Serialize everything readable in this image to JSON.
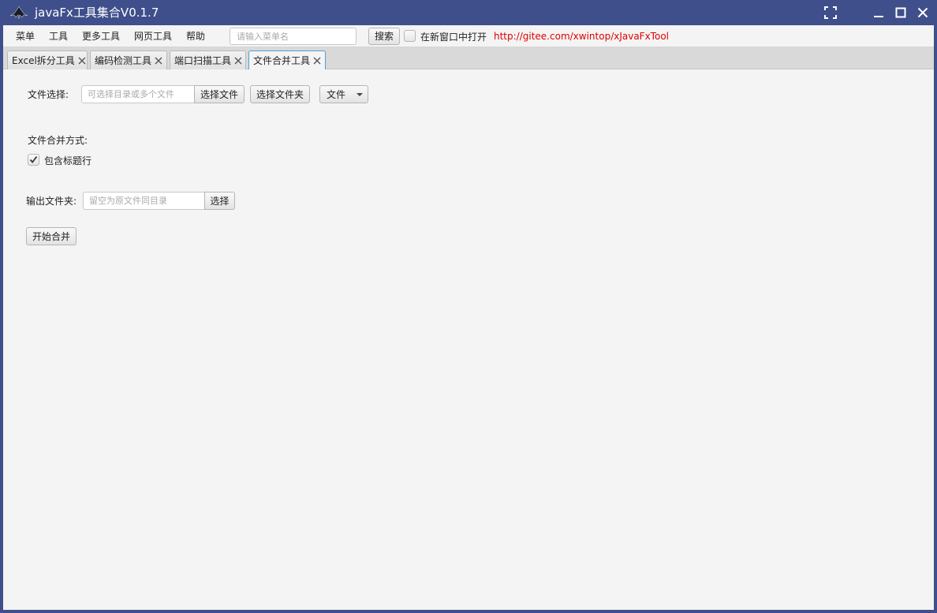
{
  "window": {
    "title": "javaFx工具集合V0.1.7",
    "title_bar_color": "#3f4f8b"
  },
  "menubar": {
    "items": [
      "菜单",
      "工具",
      "更多工具",
      "网页工具",
      "帮助"
    ],
    "search_placeholder": "请输入菜单名",
    "search_value": "",
    "search_button": "搜索",
    "new_window_label": "在新窗口中打开",
    "new_window_checked": false,
    "project_link": "http://gitee.com/xwintop/xJavaFxTool",
    "link_color": "#e00000"
  },
  "tabs": [
    {
      "label": "Excel拆分工具",
      "active": false
    },
    {
      "label": "编码检测工具",
      "active": false
    },
    {
      "label": "端口扫描工具",
      "active": false
    },
    {
      "label": "文件合并工具",
      "active": true
    }
  ],
  "panel": {
    "file_select_label": "文件选择:",
    "file_input_placeholder": "可选择目录或多个文件",
    "file_input_value": "",
    "select_file_button": "选择文件",
    "select_folder_button": "选择文件夹",
    "file_type_menu": "文件",
    "merge_mode_label": "文件合并方式:",
    "include_header_label": "包含标题行",
    "include_header_checked": true,
    "output_folder_label": "输出文件夹:",
    "output_input_placeholder": "留空为原文件同目录",
    "output_input_value": "",
    "output_select_button": "选择",
    "start_button": "开始合并"
  }
}
